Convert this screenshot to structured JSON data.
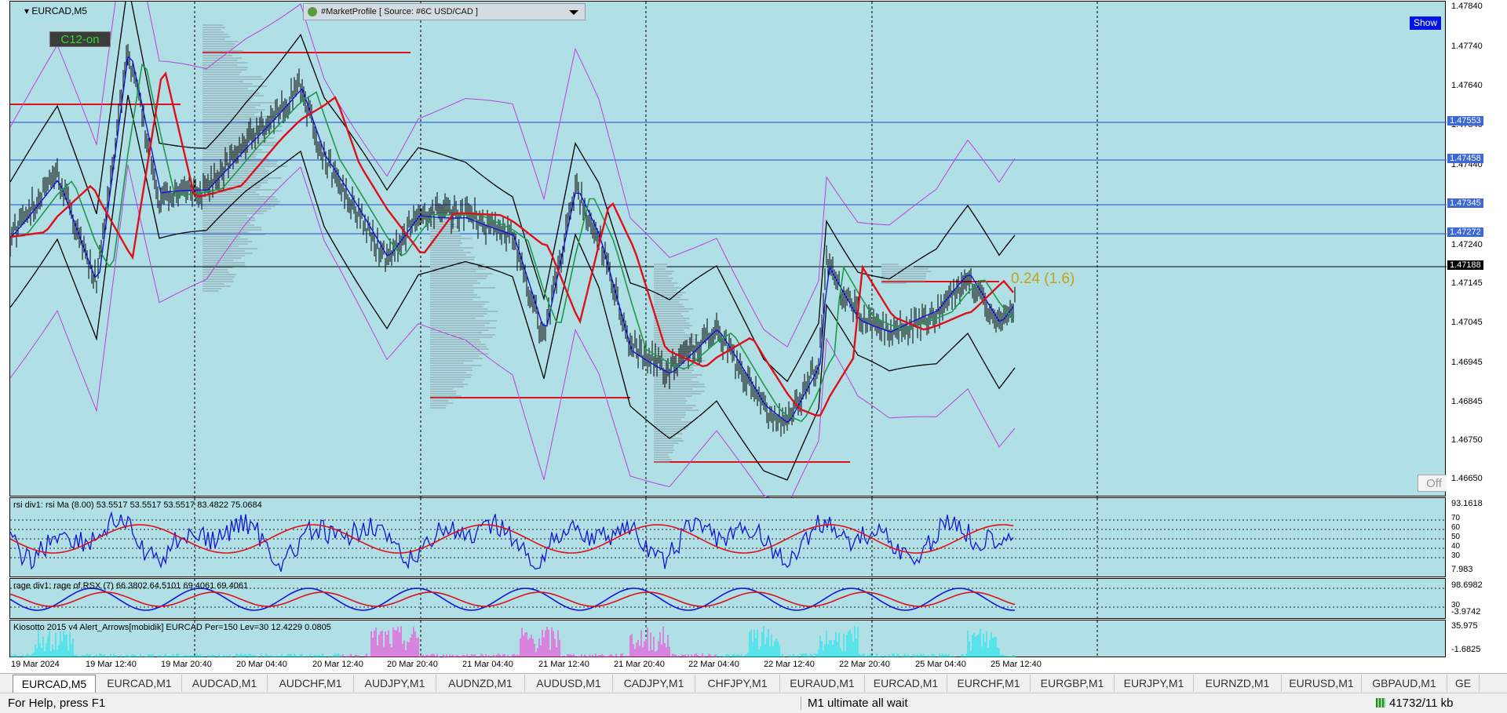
{
  "window": {
    "symbol": "EURCAD,M5"
  },
  "buttons": {
    "c12": "C12-on",
    "show": "Show",
    "off": "Off"
  },
  "market_profile": {
    "label": "#MarketProfile [ Source: #6C USD/CAD ]"
  },
  "spread_label": "0.24 (1.6)",
  "price_axis": {
    "ticks": [
      "1.47840",
      "1.47740",
      "1.47640",
      "1.47540",
      "1.47440",
      "1.47340",
      "1.47240",
      "1.47145",
      "1.47045",
      "1.46945",
      "1.46845",
      "1.46750",
      "1.46650"
    ],
    "levels": [
      "1.47553",
      "1.47458",
      "1.47345",
      "1.47272"
    ],
    "current": "1.47188"
  },
  "indicators": {
    "rsi": {
      "label": "rsi div1: rsi Ma (8.00) 53.5517 53.5517 53.5517 83.4822 75.0684",
      "max": "93.1618",
      "min": "7.983",
      "levels": [
        "70",
        "60",
        "50",
        "40",
        "30"
      ]
    },
    "rsx": {
      "label": "rage div1: rage of RSX (7) 66.3802 64.5101 69.4061 69.4061",
      "max": "98.6982",
      "mid": "30",
      "min": "-3.9742"
    },
    "kiosotto": {
      "label": "Kiosotto 2015 v4 Alert_Arrows[mobidik] EURCAD Per=150 Lev=30 12.4229 0.0805",
      "max": "35.975",
      "min": "-1.6825"
    }
  },
  "time_axis": [
    "19 Mar 2024",
    "19 Mar 12:40",
    "19 Mar 20:40",
    "20 Mar 04:40",
    "20 Mar 12:40",
    "20 Mar 20:40",
    "21 Mar 04:40",
    "21 Mar 12:40",
    "21 Mar 20:40",
    "22 Mar 04:40",
    "22 Mar 12:40",
    "22 Mar 20:40",
    "25 Mar 04:40",
    "25 Mar 12:40"
  ],
  "tabs": [
    "EURCAD,M5",
    "EURCAD,M1",
    "AUDCAD,M1",
    "AUDCHF,M1",
    "AUDJPY,M1",
    "AUDNZD,M1",
    "AUDUSD,M1",
    "CADJPY,M1",
    "CHFJPY,M1",
    "EURAUD,M1",
    "EURCAD,M1",
    "EURCHF,M1",
    "EURGBP,M1",
    "EURJPY,M1",
    "EURNZD,M1",
    "EURUSD,M1",
    "GBPAUD,M1",
    "GE"
  ],
  "status": {
    "help": "For Help, press F1",
    "profile": "M1 ultimate all wait",
    "traffic": "41732/11 kb"
  },
  "colors": {
    "background": "#b0dfe5",
    "ma_slow": "#e0101a",
    "ma_mid": "#1e9a4a",
    "ma_fast": "#1414d8",
    "bands": "#c040e0",
    "levels": "#3c68d8"
  }
}
